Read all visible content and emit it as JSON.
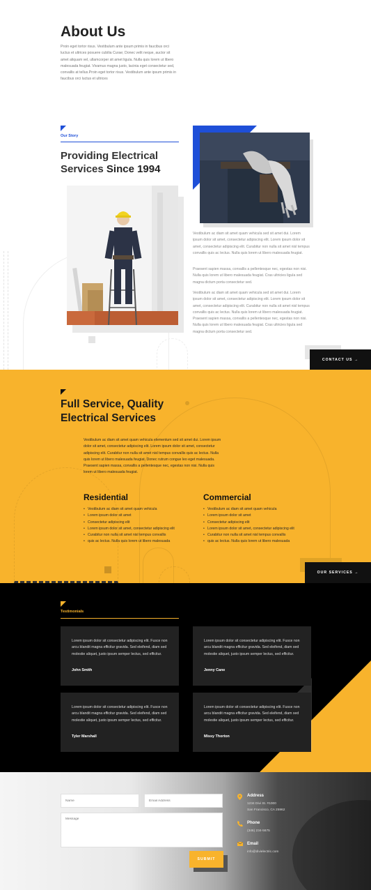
{
  "about": {
    "title": "About Us",
    "intro": "Proin eget tortor risus. Vestibulum ante ipsum primis in faucibus orci luctus et ultrices posuere cubilia Curae; Donec velit neque, auctor sit amet aliquam vel, ullamcorper sit amet ligula. Nulla quis lorem ut libero malesuada feugiat. Vivamus magna justo, lacinia eget consectetur sed, convallis at tellus.Proin eget tortor risus. Vestibulum ante ipsum primis in faucibus orci luctus et ultrices"
  },
  "story": {
    "kicker": "Our Story",
    "title_light": "Providing Electrical Services",
    "title_bold": "Since 1994",
    "paragraphs": [
      "Vestibulum ac diam sit amet quam vehicula sed sit amet dui. Lorem ipsum dolor sit amet, consectetur adipiscing elit. Lorem ipsum dolor sit amet, consectetur adipiscing elit. Curabitur non nulla sit amet nisl tempus convallis quis ac lectus. Nulla quis lorem ut libero malesuada feugiat.",
      "Praesent sapien massa, convallis a pellentesque nec, egestas non nisi. Nulla quis lorem ut libero malesuada feugiat. Cras ultricies ligula sed magna dictum porta consectetur sed.",
      "Vestibulum ac diam sit amet quam vehicula sed sit amet dui. Lorem ipsum dolor sit amet, consectetur adipiscing elit. Lorem ipsum dolor sit amet, consectetur adipiscing elit. Curabitur non nulla sit amet nisl tempus convallis quis ac lectus. Nulla quis lorem ut libero malesuada feugiat. Praesent sapien massa, convallis a pellentesque nec, egestas non nisi. Nulla quis lorem ut libero malesuada feugiat. Cras ultricies ligula sed magna dictum porta consectetur sed."
    ],
    "cta": "CONTACT US →"
  },
  "services": {
    "title_light": "Full Service, Quality",
    "title_bold": "Electrical Services",
    "body": "Vestibulum ac diam sit amet quam vehicula elementum sed sit amet dui. Lorem ipsum dolor sit amet, consectetur adipiscing elit. Lorem ipsum dolor sit amet, consectetur adipiscing elit. Curabitur non nulla sit amet nisl tempus convallis quis ac lectus. Nulla quis lorem ut libero malesuada feugiat. Donec rutrum congue leo eget malesuada. Praesent sapien massa, convallis a pellentesque nec, egestas non nisi. Nulla quis lorem ut libero malesuada feugiat.",
    "residential": {
      "title": "Residential",
      "items": [
        "Vestibulum ac diam sit amet quam vehicula",
        "Lorem ipsum dolor sit amet",
        "Consectetur adipiscing elit",
        "Lorem ipsum dolor sit amet, consectetur adipiscing elit",
        "Curabitur non nulla sit amet nisl tempus convallis",
        "quis ac lectus. Nulla quis lorem ut libero malesuada"
      ]
    },
    "commercial": {
      "title": "Commercial",
      "items": [
        "Vestibulum ac diam sit amet quam vehicula",
        "Lorem ipsum dolor sit amet",
        "Consectetur adipiscing elit",
        "Lorem ipsum dolor sit amet, consectetur adipiscing elit",
        "Curabitur non nulla sit amet nisl tempus convallis",
        "quis ac lectus. Nulla quis lorem ut libero malesuada"
      ]
    },
    "cta": "OUR SERVICES →"
  },
  "testimonials": {
    "kicker": "Testimonials",
    "cards": [
      {
        "text": "Lorem ipsum dolor sit consectetur adipiscing elit. Fusce non arcu blandit magna efficitur gravida. Sed eleifend, diam sed molestie aliquet, justo ipsum semper lectus, sed efficitur.",
        "name": "John Smith"
      },
      {
        "text": "Lorem ipsum dolor sit consectetur adipiscing elit. Fusce non arcu blandit magna efficitur gravida. Sed eleifend, diam sed molestie aliquet, justo ipsum semper lectus, sed efficitur.",
        "name": "Jenny Cane"
      },
      {
        "text": "Lorem ipsum dolor sit consectetur adipiscing elit. Fusce non arcu blandit magna efficitur gravida. Sed eleifend, diam sed molestie aliquet, justo ipsum semper lectus, sed efficitur.",
        "name": "Tyler Marshall"
      },
      {
        "text": "Lorem ipsum dolor sit consectetur adipiscing elit. Fusce non arcu blandit magna efficitur gravida. Sed eleifend, diam sed molestie aliquet, justo ipsum semper lectus, sed efficitur.",
        "name": "Missy Thorton"
      }
    ]
  },
  "contact": {
    "name_placeholder": "Name",
    "email_placeholder": "Email Address",
    "message_placeholder": "Message",
    "submit": "SUBMIT",
    "address_label": "Address",
    "address_line1": "1234 Divi St. #1000",
    "address_line2": "San Francisco, CA 25962",
    "phone_label": "Phone",
    "phone_value": "(346) 234-5675",
    "email_label": "Email",
    "email_value": "info@divielectric.com"
  },
  "colors": {
    "accent_blue": "#1e4fd8",
    "accent_yellow": "#f8b32c",
    "dark": "#000000"
  },
  "icons": [
    "map-pin-icon",
    "phone-icon",
    "envelope-icon",
    "arrow-right-icon"
  ]
}
